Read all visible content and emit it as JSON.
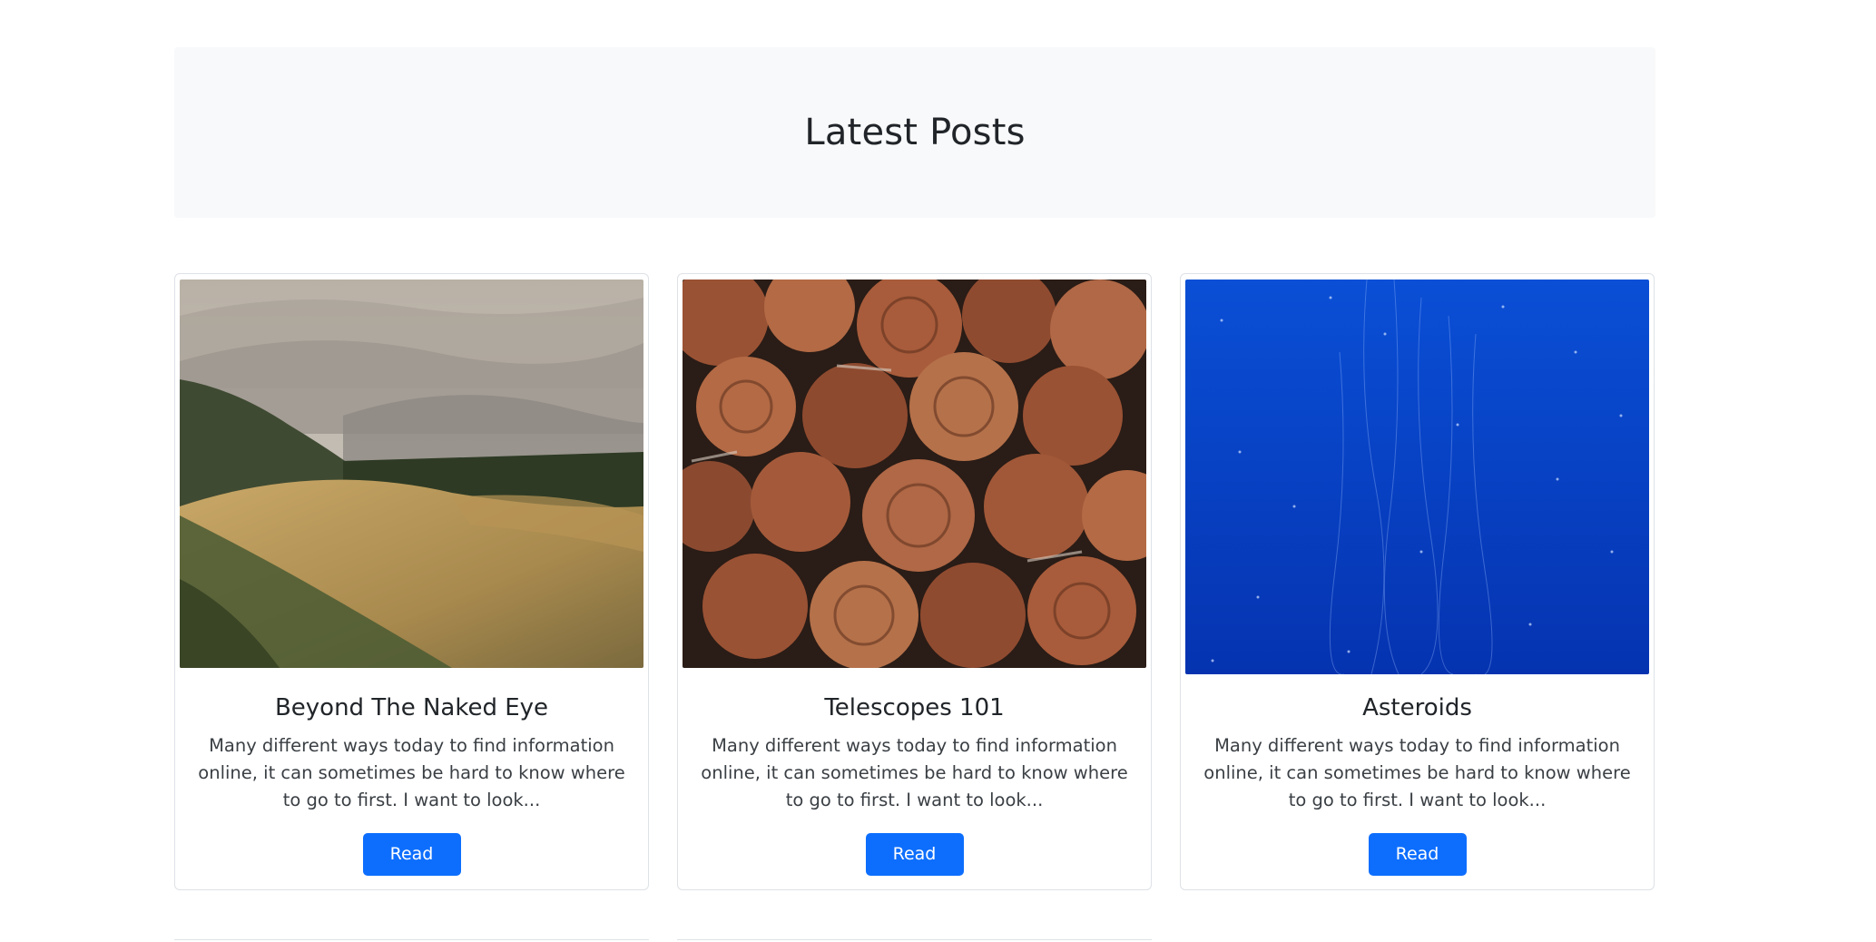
{
  "header": {
    "title": "Latest Posts"
  },
  "posts": [
    {
      "title": "Beyond The Naked Eye",
      "excerpt": "Many different ways today to find information online, it can sometimes be hard to know where to go to first. I want to look...",
      "button_label": "Read",
      "image_subject": "mountain-landscape"
    },
    {
      "title": "Telescopes 101",
      "excerpt": "Many different ways today to find information online, it can sometimes be hard to know where to go to first. I want to look...",
      "button_label": "Read",
      "image_subject": "stacked-firewood"
    },
    {
      "title": "Asteroids",
      "excerpt": "Many different ways today to find information online, it can sometimes be hard to know where to go to first. I want to look...",
      "button_label": "Read",
      "image_subject": "deep-blue-water"
    }
  ],
  "colors": {
    "primary": "#0d6efd",
    "hero_bg": "#f8f9fa",
    "card_border": "#dee2e6",
    "text": "#212529"
  }
}
